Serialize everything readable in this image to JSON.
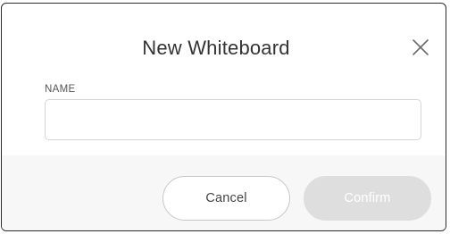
{
  "dialog": {
    "title": "New Whiteboard",
    "close_icon": "close-icon",
    "name_field": {
      "label": "NAME",
      "value": "",
      "placeholder": ""
    },
    "buttons": {
      "cancel_label": "Cancel",
      "confirm_label": "Confirm",
      "confirm_state": "disabled"
    }
  },
  "colors": {
    "border": "#2b2b2b",
    "footer_bg": "#f7f7f7",
    "confirm_disabled_bg": "#dedede"
  }
}
